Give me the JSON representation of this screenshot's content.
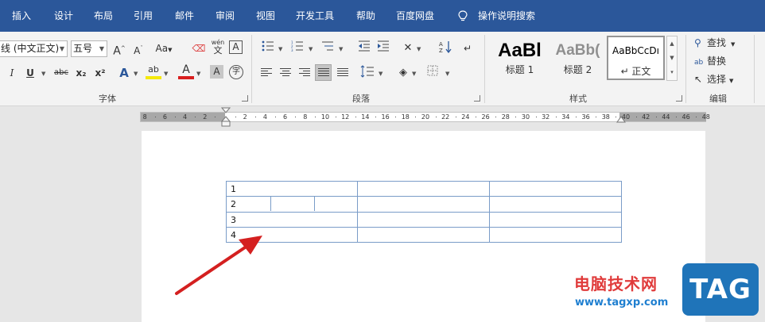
{
  "menu_tabs": [
    "插入",
    "设计",
    "布局",
    "引用",
    "邮件",
    "审阅",
    "视图",
    "开发工具",
    "帮助",
    "百度网盘",
    "操作说明搜索"
  ],
  "font_group": {
    "font_name": "线 (中文正文)",
    "font_size": "五号",
    "grow_font": "A",
    "shrink_font": "A",
    "change_case": "Aa",
    "pinyin_top": "wén",
    "pinyin_bottom": "文",
    "char_border": "A",
    "italic": "I",
    "underline": "U",
    "strikethrough": "abc",
    "subscript": "x₂",
    "superscript": "x²",
    "text_effects": "A",
    "highlight": "ab",
    "font_color": "A",
    "char_shading": "A",
    "enclose_char": "字",
    "label": "字体"
  },
  "paragraph_group": {
    "label": "段落"
  },
  "styles_group": {
    "label": "样式",
    "items": [
      {
        "preview": "AaBl",
        "name": "标题 1"
      },
      {
        "preview": "AaBb(",
        "name": "标题 2"
      },
      {
        "preview": "AaBbCcDı",
        "name": "↵ 正文"
      }
    ]
  },
  "editing_group": {
    "label": "编辑",
    "find": "查找",
    "replace": "替换",
    "select": "选择"
  },
  "ruler": {
    "left_labels": [
      "8",
      "6",
      "4",
      "2"
    ],
    "right_labels": [
      "2",
      "4",
      "6",
      "8",
      "10",
      "12",
      "14",
      "16",
      "18",
      "20",
      "22",
      "24",
      "26",
      "28",
      "30",
      "32",
      "34",
      "36",
      "38",
      "40",
      "42",
      "44",
      "46",
      "48"
    ]
  },
  "document": {
    "table_rows": [
      "1",
      "2",
      "3",
      "4"
    ]
  },
  "watermark": {
    "site_name": "电脑技术网",
    "url": "www.tagxp.com",
    "logo": "TAG"
  },
  "colors": {
    "title_bar": "#2b579a",
    "table_border": "#7a9cc8",
    "arrow": "#d42020",
    "watermark_red": "#e03b3b",
    "watermark_blue": "#1f7fd0"
  }
}
